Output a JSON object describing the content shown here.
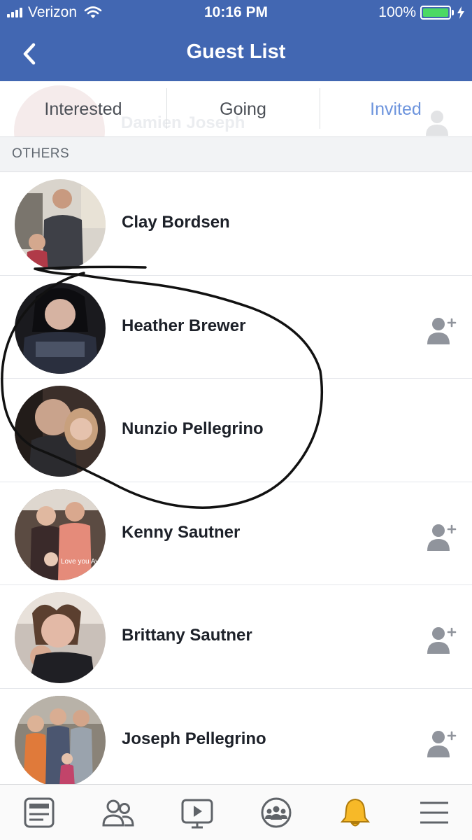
{
  "status_bar": {
    "carrier": "Verizon",
    "time": "10:16 PM",
    "battery": "100%"
  },
  "nav": {
    "title": "Guest List",
    "back_icon": "chevron-left-icon"
  },
  "ghost_row": {
    "name": "Damien Joseph"
  },
  "tabs": [
    {
      "label": "Interested",
      "active": false
    },
    {
      "label": "Going",
      "active": false
    },
    {
      "label": "Invited",
      "active": true
    }
  ],
  "section_header": "OTHERS",
  "guests": [
    {
      "name": "Clay Bordsen",
      "add_friend": false
    },
    {
      "name": "Heather Brewer",
      "add_friend": true
    },
    {
      "name": "Nunzio Pellegrino",
      "add_friend": false
    },
    {
      "name": "Kenny Sautner",
      "add_friend": true
    },
    {
      "name": "Brittany Sautner",
      "add_friend": true
    },
    {
      "name": "Joseph Pellegrino",
      "add_friend": true
    }
  ],
  "avatar_captions": {
    "kenny": "Love you Avery"
  },
  "bottom_tabs": [
    {
      "icon": "news-feed-icon",
      "active": false
    },
    {
      "icon": "friends-icon",
      "active": false
    },
    {
      "icon": "watch-icon",
      "active": false
    },
    {
      "icon": "groups-icon",
      "active": false
    },
    {
      "icon": "notifications-bell-icon",
      "active": true
    },
    {
      "icon": "menu-icon",
      "active": false
    }
  ],
  "colors": {
    "brand": "#4267b2",
    "active_tab": "#6d94dd",
    "bell_active": "#f7b928",
    "battery": "#4cd964"
  }
}
